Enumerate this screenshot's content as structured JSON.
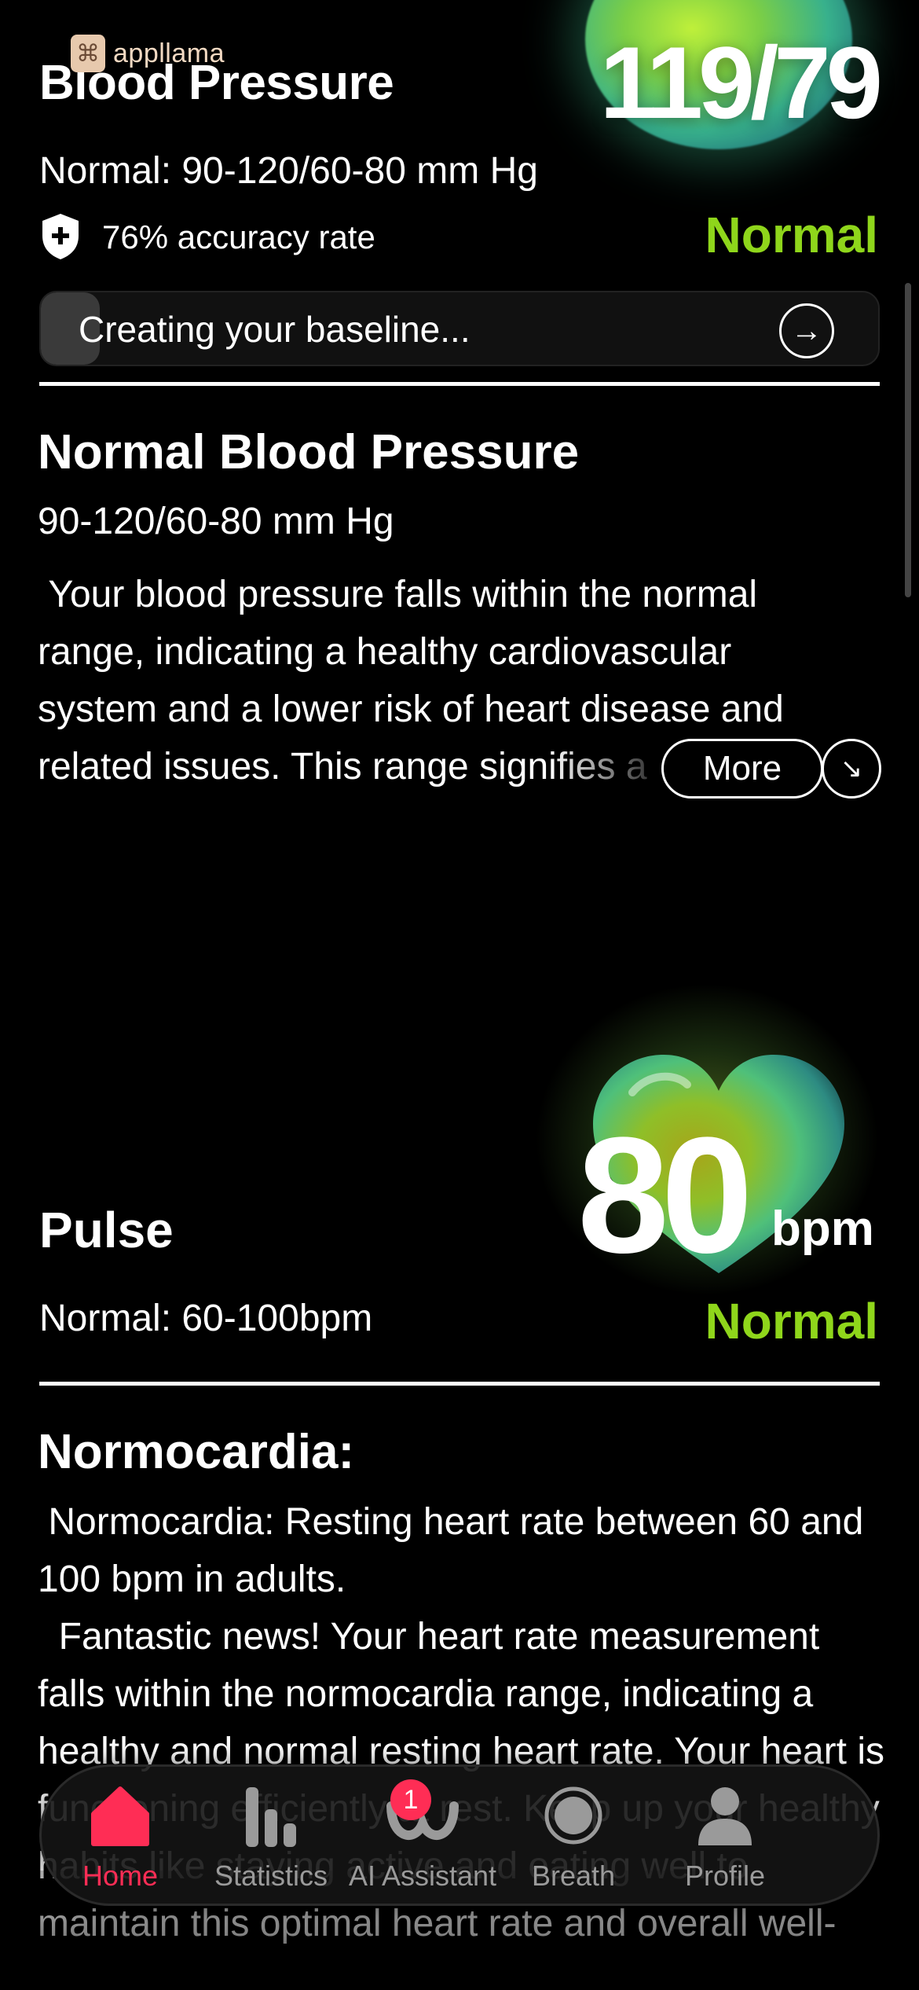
{
  "brand": {
    "name": "appllama"
  },
  "blood_pressure": {
    "title": "Blood Pressure",
    "value": "119/79",
    "normal_range": "Normal: 90-120/60-80 mm Hg",
    "accuracy": "76% accuracy rate",
    "status": "Normal",
    "status_color": "#8fd61b",
    "baseline": {
      "label": "Creating your baseline...",
      "progress": 0.07
    },
    "section": {
      "title": "Normal Blood Pressure",
      "range": "90-120/60-80 mm Hg",
      "description": " Your blood pressure falls within the normal range, indicating a healthy cardiovascular system and a lower risk of heart disease and related issues. This range signifies a",
      "more_label": "More"
    }
  },
  "pulse": {
    "title": "Pulse",
    "value": "80",
    "unit": "bpm",
    "normal_range": "Normal: 60-100bpm",
    "status": "Normal",
    "section": {
      "title": "Normocardia:",
      "description": " Normocardia: Resting heart rate between 60 and 100 bpm in adults.\n  Fantastic news! Your heart rate measurement falls within the normocardia range, indicating a healthy and normal resting heart rate. Your heart is functioning efficiently at rest. Keep up your healthy habits like staying active and eating well to maintain this optimal heart rate and overall well-"
    }
  },
  "tabbar": {
    "accent_color": "#ff2d55",
    "items": [
      {
        "label": "Home",
        "icon": "home-icon",
        "active": true
      },
      {
        "label": "Statistics",
        "icon": "bar-chart-icon",
        "active": false
      },
      {
        "label": "AI Assistant",
        "icon": "ai-assistant-icon",
        "active": false,
        "badge": "1"
      },
      {
        "label": "Breath",
        "icon": "breath-icon",
        "active": false
      },
      {
        "label": "Profile",
        "icon": "profile-icon",
        "active": false
      }
    ]
  }
}
